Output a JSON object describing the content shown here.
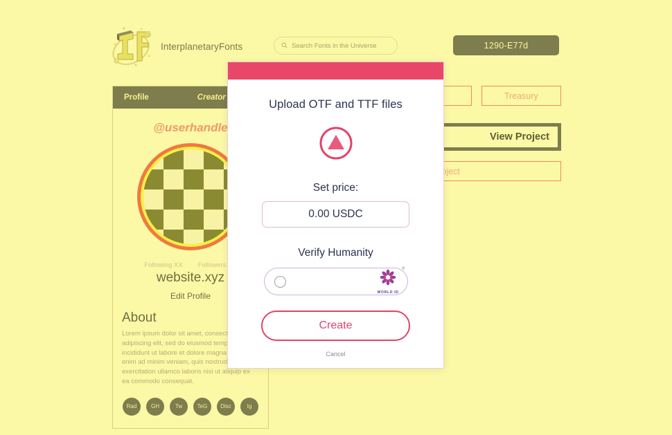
{
  "header": {
    "brand_name": "InterplanetaryFonts",
    "logo_icon": "if-monogram-logo",
    "search": {
      "placeholder": "Search Fonts in the Universe",
      "value": "",
      "icon": "search-icon"
    },
    "wallet_label": "1290-E77d"
  },
  "profile": {
    "tabs": [
      {
        "label": "Profile",
        "active": true
      },
      {
        "label": "Creator",
        "active": false
      }
    ],
    "handle": "@userhandle",
    "avatar_icon": "checkerboard-avatar",
    "following": "Following XX",
    "followers": "Followers XX",
    "website": "website.xyz",
    "edit_profile": "Edit Profile",
    "about_title": "About",
    "about_body": "Lorem ipsum dolor sit amet, consectetur adipiscing elit, sed do eiusmod tempor incididunt ut labore et dolore magna aliqua. Ut enim ad minim veniam, quis nostrud exercitation ullamco laboris nisi ut aliquip ex ea commodo consequat.",
    "badges": [
      "Rad",
      "GH",
      "Tw",
      "TeG",
      "Disc",
      "Ig"
    ]
  },
  "right_panel": {
    "secondary_button": "",
    "treasury_label": "Treasury",
    "view_project_label": "View Project",
    "create_project_label": "Create Project"
  },
  "modal": {
    "title": "Upload OTF and TTF files",
    "upload_icon": "upload-triangle-icon",
    "price_label": "Set price:",
    "price_value": "0.00 USDC",
    "price_placeholder": "0.00 USDC",
    "verify_label": "Verify Humanity",
    "worldid": {
      "brand_text": "WORLD ID",
      "registered_mark": "®",
      "checkbox_checked": false
    },
    "create_label": "Create",
    "cancel_label": "Cancel"
  },
  "colors": {
    "page_bg": "#fbf8a6",
    "accent_pink": "#e8476a",
    "olive": "#7d7d4e",
    "orange": "#ef8c55",
    "navy_text": "#2b3250"
  }
}
